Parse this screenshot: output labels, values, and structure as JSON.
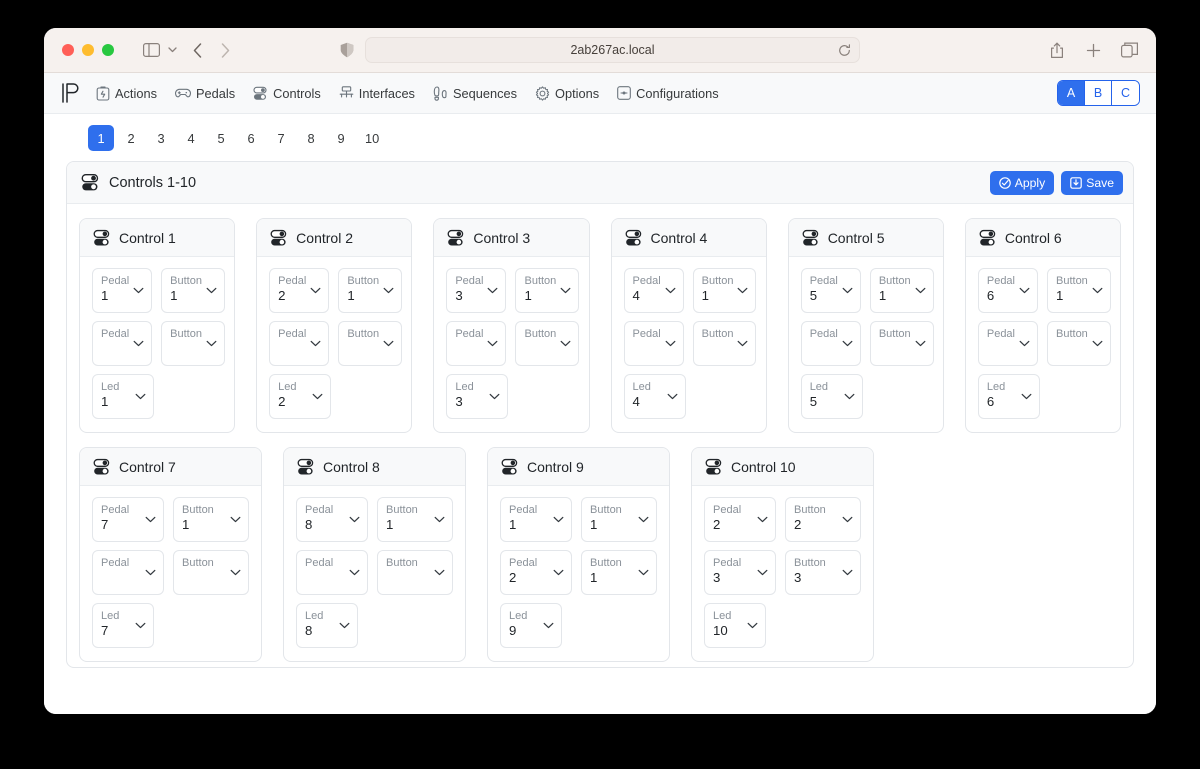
{
  "browser": {
    "url": "2ab267ac.local",
    "icons": {
      "sidebar": "sidebar-icon",
      "chevron": "chevron-down-icon",
      "back": "back-arrow-icon",
      "forward": "forward-arrow-icon",
      "shield": "shield-icon",
      "reload": "reload-icon",
      "share": "share-icon",
      "new_tab": "plus-icon",
      "tabs": "tab-overview-icon"
    }
  },
  "app": {
    "logo": "pedalino-logo",
    "nav": [
      {
        "label": "Actions",
        "icon": "clipboard-icon"
      },
      {
        "label": "Pedals",
        "icon": "gamepad-icon"
      },
      {
        "label": "Controls",
        "icon": "toggles-icon"
      },
      {
        "label": "Interfaces",
        "icon": "network-icon"
      },
      {
        "label": "Sequences",
        "icon": "footprints-icon"
      },
      {
        "label": "Options",
        "icon": "gear-icon"
      },
      {
        "label": "Configurations",
        "icon": "config-icon"
      }
    ],
    "profiles": {
      "items": [
        "A",
        "B",
        "C"
      ],
      "active": "A"
    },
    "pages": {
      "items": [
        "1",
        "2",
        "3",
        "4",
        "5",
        "6",
        "7",
        "8",
        "9",
        "10"
      ],
      "active": "1"
    },
    "panel": {
      "title": "Controls 1-10",
      "icon": "toggles-icon",
      "apply_label": "Apply",
      "apply_icon": "check-circle-icon",
      "save_label": "Save",
      "save_icon": "save-icon"
    },
    "accent_color": "#2f6fed",
    "controls": [
      {
        "title": "Control 1",
        "fields": [
          {
            "label": "Pedal",
            "value": "1"
          },
          {
            "label": "Button",
            "value": "1"
          },
          {
            "label": "Pedal",
            "value": ""
          },
          {
            "label": "Button",
            "value": ""
          },
          {
            "label": "Led",
            "value": "1"
          }
        ]
      },
      {
        "title": "Control 2",
        "fields": [
          {
            "label": "Pedal",
            "value": "2"
          },
          {
            "label": "Button",
            "value": "1"
          },
          {
            "label": "Pedal",
            "value": ""
          },
          {
            "label": "Button",
            "value": ""
          },
          {
            "label": "Led",
            "value": "2"
          }
        ]
      },
      {
        "title": "Control 3",
        "fields": [
          {
            "label": "Pedal",
            "value": "3"
          },
          {
            "label": "Button",
            "value": "1"
          },
          {
            "label": "Pedal",
            "value": ""
          },
          {
            "label": "Button",
            "value": ""
          },
          {
            "label": "Led",
            "value": "3"
          }
        ]
      },
      {
        "title": "Control 4",
        "fields": [
          {
            "label": "Pedal",
            "value": "4"
          },
          {
            "label": "Button",
            "value": "1"
          },
          {
            "label": "Pedal",
            "value": ""
          },
          {
            "label": "Button",
            "value": ""
          },
          {
            "label": "Led",
            "value": "4"
          }
        ]
      },
      {
        "title": "Control 5",
        "fields": [
          {
            "label": "Pedal",
            "value": "5"
          },
          {
            "label": "Button",
            "value": "1"
          },
          {
            "label": "Pedal",
            "value": ""
          },
          {
            "label": "Button",
            "value": ""
          },
          {
            "label": "Led",
            "value": "5"
          }
        ]
      },
      {
        "title": "Control 6",
        "fields": [
          {
            "label": "Pedal",
            "value": "6"
          },
          {
            "label": "Button",
            "value": "1"
          },
          {
            "label": "Pedal",
            "value": ""
          },
          {
            "label": "Button",
            "value": ""
          },
          {
            "label": "Led",
            "value": "6"
          }
        ]
      },
      {
        "title": "Control 7",
        "fields": [
          {
            "label": "Pedal",
            "value": "7"
          },
          {
            "label": "Button",
            "value": "1"
          },
          {
            "label": "Pedal",
            "value": ""
          },
          {
            "label": "Button",
            "value": ""
          },
          {
            "label": "Led",
            "value": "7"
          }
        ]
      },
      {
        "title": "Control 8",
        "fields": [
          {
            "label": "Pedal",
            "value": "8"
          },
          {
            "label": "Button",
            "value": "1"
          },
          {
            "label": "Pedal",
            "value": ""
          },
          {
            "label": "Button",
            "value": ""
          },
          {
            "label": "Led",
            "value": "8"
          }
        ]
      },
      {
        "title": "Control 9",
        "fields": [
          {
            "label": "Pedal",
            "value": "1"
          },
          {
            "label": "Button",
            "value": "1"
          },
          {
            "label": "Pedal",
            "value": "2"
          },
          {
            "label": "Button",
            "value": "1"
          },
          {
            "label": "Led",
            "value": "9"
          }
        ]
      },
      {
        "title": "Control 10",
        "fields": [
          {
            "label": "Pedal",
            "value": "2"
          },
          {
            "label": "Button",
            "value": "2"
          },
          {
            "label": "Pedal",
            "value": "3"
          },
          {
            "label": "Button",
            "value": "3"
          },
          {
            "label": "Led",
            "value": "10"
          }
        ]
      }
    ]
  }
}
